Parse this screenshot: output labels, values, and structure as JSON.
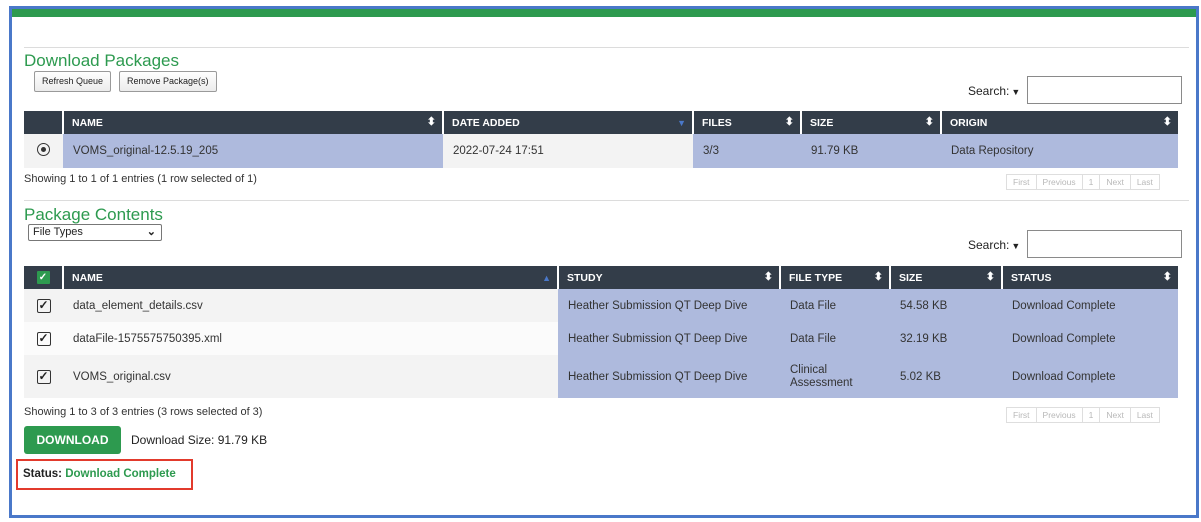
{
  "packages": {
    "title": "Download Packages",
    "buttons": {
      "refresh": "Refresh Queue",
      "remove": "Remove Package(s)"
    },
    "search_label": "Search:",
    "columns": [
      "NAME",
      "DATE ADDED",
      "FILES",
      "SIZE",
      "ORIGIN"
    ],
    "rows": [
      {
        "name": "VOMS_original-12.5.19_205",
        "date_added": "2022-07-24 17:51",
        "files": "3/3",
        "size": "91.79 KB",
        "origin": "Data Repository",
        "selected": true
      }
    ],
    "info": "Showing 1 to 1 of 1 entries (1 row selected of 1)",
    "pager": [
      "First",
      "Previous",
      "1",
      "Next",
      "Last"
    ]
  },
  "contents": {
    "title": "Package Contents",
    "filter_value": "File Types",
    "search_label": "Search:",
    "columns": [
      "NAME",
      "STUDY",
      "FILE TYPE",
      "SIZE",
      "STATUS"
    ],
    "rows": [
      {
        "name": "data_element_details.csv",
        "study": "Heather Submission QT Deep Dive",
        "file_type": "Data File",
        "size": "54.58 KB",
        "status": "Download Complete",
        "checked": true
      },
      {
        "name": "dataFile-1575575750395.xml",
        "study": "Heather Submission QT Deep Dive",
        "file_type": "Data File",
        "size": "32.19 KB",
        "status": "Download Complete",
        "checked": true
      },
      {
        "name": "VOMS_original.csv",
        "study": "Heather Submission QT Deep Dive",
        "file_type": "Clinical Assessment",
        "size": "5.02 KB",
        "status": "Download Complete",
        "checked": true
      }
    ],
    "info": "Showing 1 to 3 of 3 entries (3 rows selected of 3)",
    "pager": [
      "First",
      "Previous",
      "1",
      "Next",
      "Last"
    ]
  },
  "download": {
    "button_label": "DOWNLOAD",
    "size_text": "Download Size: 91.79 KB"
  },
  "status": {
    "label": "Status:",
    "value": "Download Complete"
  },
  "colors": {
    "brand_green": "#2d9a4f",
    "header_dark": "#333d49",
    "selected_blue": "#aebadd",
    "frame_blue": "#4a78c9",
    "highlight_red": "#e23a2c"
  }
}
